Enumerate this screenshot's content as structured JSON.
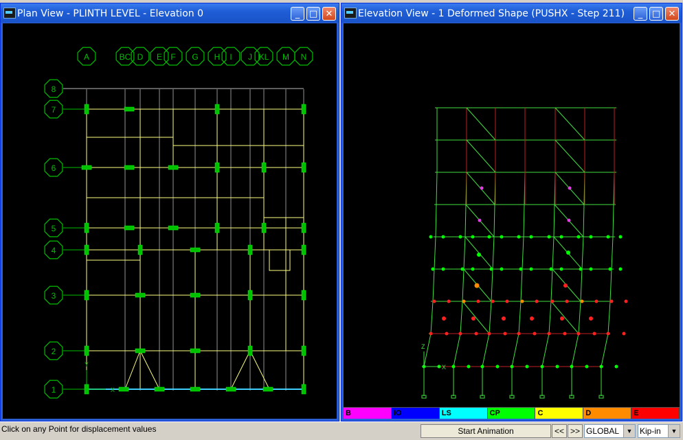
{
  "plan_window": {
    "title": "Plan View - PLINTH LEVEL - Elevation 0",
    "grid_x_labels": [
      "A",
      "BC",
      "D",
      "E",
      "F",
      "G",
      "H",
      "I",
      "J",
      "KL",
      "M",
      "N"
    ],
    "grid_y_labels": [
      "8",
      "7",
      "6",
      "5",
      "4",
      "3",
      "2",
      "1"
    ],
    "axis_x_label": "X",
    "axis_y_label": "Y"
  },
  "elevation_window": {
    "title": "Elevation View - 1  Deformed Shape (PUSHX - Step 211)",
    "axis_x_label": "X",
    "axis_z_label": "Z",
    "legend": [
      {
        "label": "B",
        "color": "#ff00ff"
      },
      {
        "label": "IO",
        "color": "#0000ff"
      },
      {
        "label": "LS",
        "color": "#00ffff"
      },
      {
        "label": "CP",
        "color": "#00ff00"
      },
      {
        "label": "C",
        "color": "#ffff00"
      },
      {
        "label": "D",
        "color": "#ff8c00"
      },
      {
        "label": "E",
        "color": "#ff0000"
      }
    ]
  },
  "status": {
    "message": "Click on any Point for displacement values",
    "animate_label": "Start Animation",
    "prev_label": "<<",
    "next_label": ">>",
    "coord_system": "GLOBAL",
    "units": "Kip-in"
  },
  "colors": {
    "grid_green": "#00c000",
    "plan_beam": "#ffff80",
    "deformed_frame": "#40e040",
    "bay_red": "#c02020"
  }
}
